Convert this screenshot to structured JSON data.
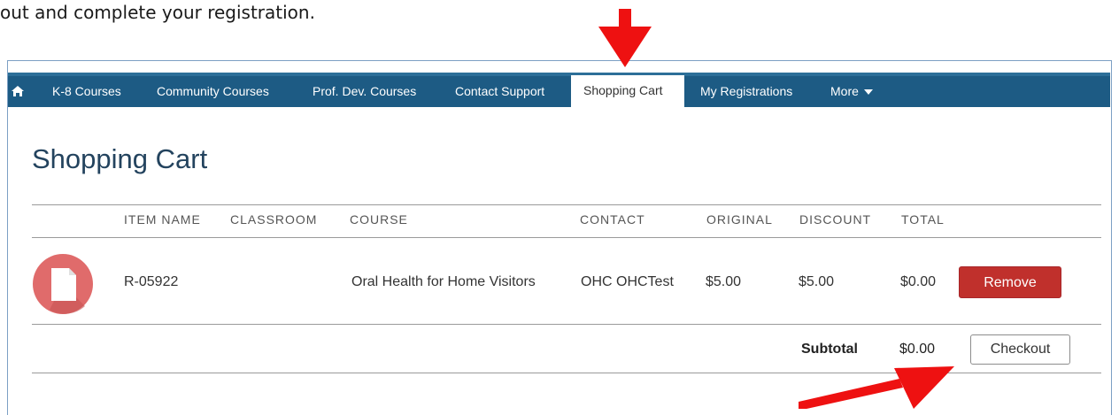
{
  "intro_text": "out and complete your registration.",
  "nav": {
    "items": [
      {
        "label": "K-8 Courses"
      },
      {
        "label": "Community Courses"
      },
      {
        "label": "Prof. Dev. Courses"
      },
      {
        "label": "Contact Support"
      },
      {
        "label": "Shopping Cart"
      },
      {
        "label": "My Registrations"
      },
      {
        "label": "More"
      }
    ],
    "home_icon": "home-icon",
    "active": "Shopping Cart"
  },
  "page": {
    "title": "Shopping Cart"
  },
  "table": {
    "headers": [
      "ITEM NAME",
      "CLASSROOM",
      "COURSE",
      "CONTACT",
      "ORIGINAL",
      "DISCOUNT",
      "TOTAL"
    ],
    "row": {
      "icon": "document-icon",
      "item_name": "R-05922",
      "classroom": "",
      "course": "Oral Health for Home Visitors",
      "contact": "OHC OHCTest",
      "original": "$5.00",
      "discount": "$5.00",
      "total": "$0.00",
      "remove_label": "Remove"
    },
    "subtotal_label": "Subtotal",
    "subtotal_value": "$0.00",
    "checkout_label": "Checkout"
  },
  "colors": {
    "nav_bg": "#1d5b84",
    "title": "#23435e",
    "remove_btn": "#c0302c",
    "annotation_arrow": "#ee1111"
  }
}
